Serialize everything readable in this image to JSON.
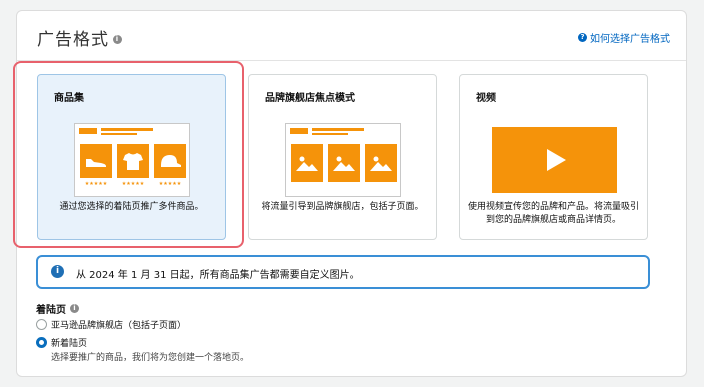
{
  "header": {
    "title": "广告格式",
    "help_link": "如何选择广告格式"
  },
  "cards": [
    {
      "title": "商品集",
      "description": "通过您选择的着陆页推广多件商品。",
      "selected": true
    },
    {
      "title": "品牌旗舰店焦点模式",
      "description": "将流量引导到品牌旗舰店，包括子页面。",
      "selected": false
    },
    {
      "title": "视频",
      "description": "使用视频宣传您的品牌和产品。将流量吸引到您的品牌旗舰店或商品详情页。",
      "selected": false
    }
  ],
  "notice": {
    "text": "从 2024 年 1 月 31 日起，所有商品集广告都需要自定义图片。"
  },
  "landing_page": {
    "label": "着陆页",
    "options": [
      {
        "label": "亚马逊品牌旗舰店（包括子页面）",
        "selected": false
      },
      {
        "label": "新着陆页",
        "selected": true,
        "description": "选择要推广的商品，我们将为您创建一个落地页。"
      }
    ]
  },
  "colors": {
    "accent": "#f5930a",
    "link": "#0066c0",
    "selected_bg": "#e8f2fb",
    "highlight_border": "#e8616c"
  },
  "thumbnail_rating": "★★★★★"
}
